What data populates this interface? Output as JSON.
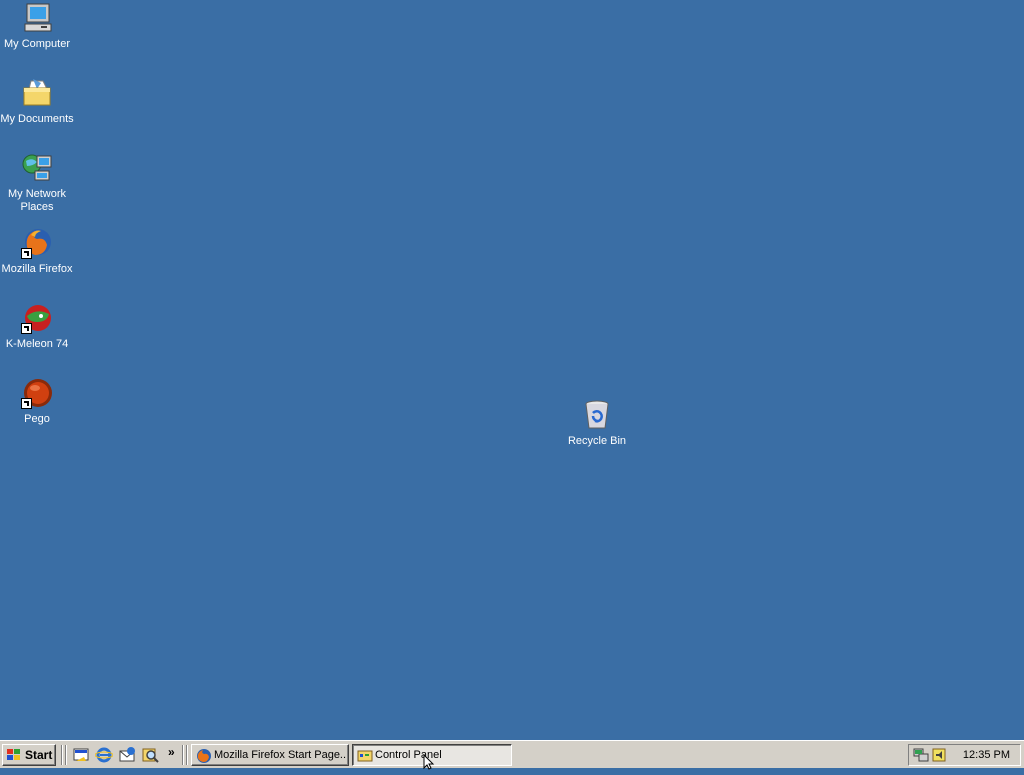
{
  "desktop": {
    "background": "#3a6ea5",
    "icons": [
      {
        "label": "My Computer"
      },
      {
        "label": "My Documents"
      },
      {
        "label": "My Network Places"
      },
      {
        "label": "Mozilla Firefox"
      },
      {
        "label": "K-Meleon 74"
      },
      {
        "label": "Pego"
      },
      {
        "label": "Recycle Bin"
      }
    ]
  },
  "taskbar": {
    "start_label": "Start",
    "quick_launch_more": "»",
    "tasks": [
      {
        "label": "Mozilla Firefox Start Page...",
        "active": false
      },
      {
        "label": "Control Panel",
        "active": true
      }
    ],
    "clock": "12:35 PM"
  }
}
